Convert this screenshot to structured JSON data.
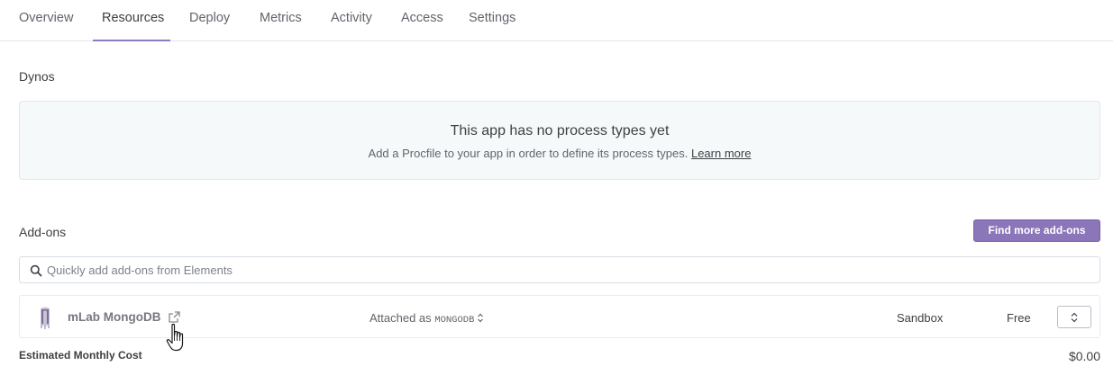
{
  "tabs": [
    {
      "label": "Overview"
    },
    {
      "label": "Resources",
      "active": true
    },
    {
      "label": "Deploy"
    },
    {
      "label": "Metrics"
    },
    {
      "label": "Activity"
    },
    {
      "label": "Access"
    },
    {
      "label": "Settings"
    }
  ],
  "dynos": {
    "title": "Dynos",
    "empty_title": "This app has no process types yet",
    "empty_text": "Add a Procfile to your app in order to define its process types.",
    "learn_more": "Learn more"
  },
  "addons": {
    "title": "Add-ons",
    "find_button": "Find more add-ons",
    "search_placeholder": "Quickly add add-ons from Elements",
    "items": [
      {
        "icon": "mlab-logo-icon",
        "name": "mLab MongoDB",
        "attached_prefix": "Attached as",
        "attached_name": "MONGODB",
        "plan": "Sandbox",
        "price": "Free"
      }
    ]
  },
  "cost": {
    "label": "Estimated Monthly Cost",
    "value": "$0.00"
  },
  "colors": {
    "accent": "#8b76b9",
    "text": "#3f3f44",
    "muted": "#62646b",
    "empty_bg": "#f6f9fa"
  }
}
